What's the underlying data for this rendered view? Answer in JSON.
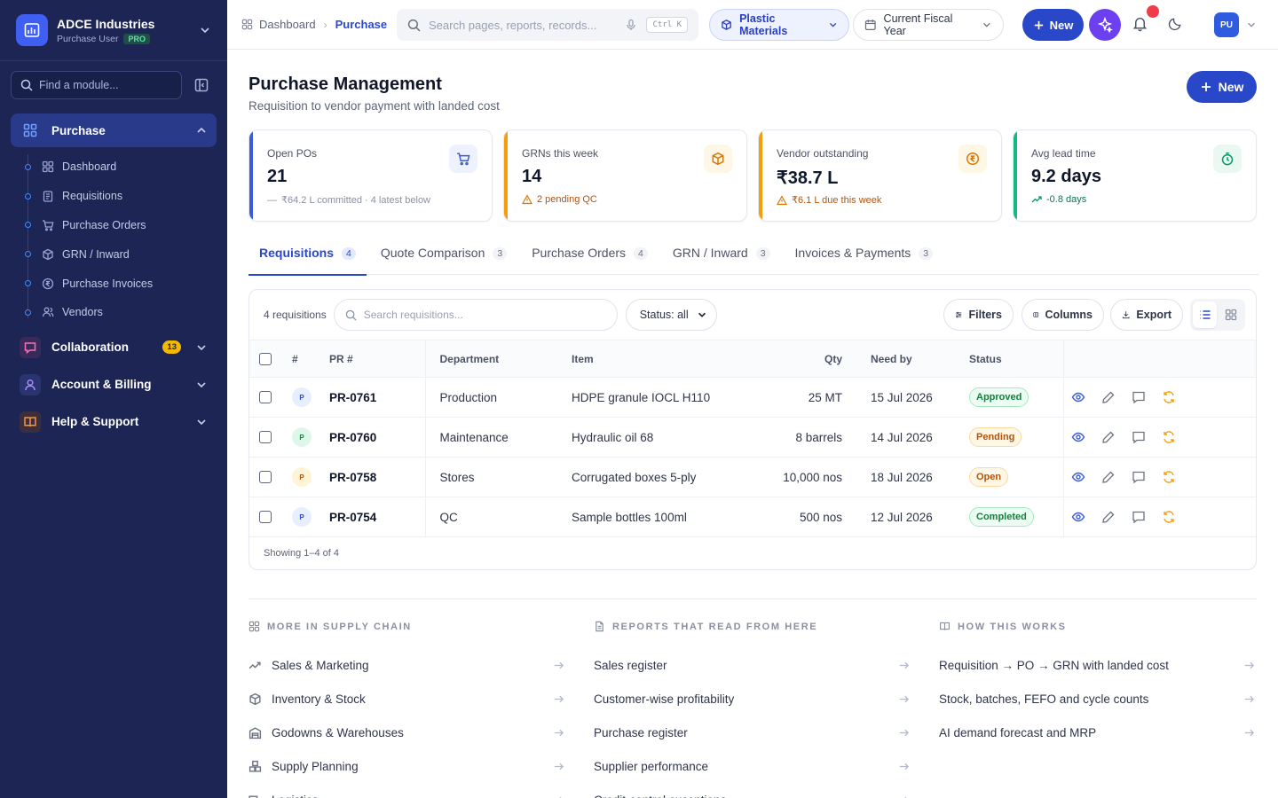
{
  "brand": {
    "name": "ADCE Industries",
    "role": "Purchase User",
    "tier": "PRO"
  },
  "sidebar": {
    "search_placeholder": "Find a module...",
    "groups": [
      {
        "label": "Purchase",
        "active": true,
        "items": [
          {
            "label": "Dashboard",
            "icon": "grid-icon"
          },
          {
            "label": "Requisitions",
            "icon": "clipboard-icon"
          },
          {
            "label": "Purchase Orders",
            "icon": "cart-icon"
          },
          {
            "label": "GRN / Inward",
            "icon": "box-icon"
          },
          {
            "label": "Purchase Invoices",
            "icon": "rupee-icon"
          },
          {
            "label": "Vendors",
            "icon": "users-icon"
          }
        ]
      },
      {
        "label": "Collaboration",
        "badge": "13"
      },
      {
        "label": "Account & Billing"
      },
      {
        "label": "Help & Support"
      }
    ]
  },
  "topbar": {
    "breadcrumb": [
      "Dashboard",
      "Purchase"
    ],
    "search_placeholder": "Search pages, reports, records...",
    "shortcut": "Ctrl K",
    "material": "Plastic Materials",
    "period": "Current Fiscal Year",
    "new_label": "New",
    "user_initials": "PU"
  },
  "page": {
    "title": "Purchase Management",
    "subtitle": "Requisition to vendor payment with landed cost",
    "new_label": "New"
  },
  "kpis": [
    {
      "label": "Open POs",
      "value": "21",
      "note": "₹64.2 L committed · 4 latest below",
      "accent": "#3b5bdb",
      "tone": "neutral"
    },
    {
      "label": "GRNs this week",
      "value": "14",
      "note": "2 pending QC",
      "accent": "#f59e0b",
      "tone": "warn"
    },
    {
      "label": "Vendor outstanding",
      "value": "₹38.7 L",
      "note": "₹6.1 L due this week",
      "accent": "#f59e0b",
      "tone": "warn"
    },
    {
      "label": "Avg lead time",
      "value": "9.2 days",
      "note": "-0.8 days",
      "accent": "#10b981",
      "tone": "good"
    }
  ],
  "tabs": [
    {
      "label": "Requisitions",
      "count": "4",
      "active": true
    },
    {
      "label": "Quote Comparison",
      "count": "3"
    },
    {
      "label": "Purchase Orders",
      "count": "4"
    },
    {
      "label": "GRN / Inward",
      "count": "3"
    },
    {
      "label": "Invoices & Payments",
      "count": "3"
    }
  ],
  "table": {
    "count_label": "4 requisitions",
    "search_placeholder": "Search requisitions...",
    "status_filter": "Status: all",
    "buttons": {
      "filters": "Filters",
      "columns": "Columns",
      "export": "Export"
    },
    "columns": [
      "#",
      "PR #",
      "Department",
      "Item",
      "Qty",
      "Need by",
      "Status"
    ],
    "rows": [
      {
        "avatar": "P",
        "pr": "PR-0761",
        "dept": "Production",
        "item": "HDPE granule IOCL H110",
        "qty": "25 MT",
        "need_by": "15 Jul 2026",
        "status": "Approved"
      },
      {
        "avatar": "P",
        "pr": "PR-0760",
        "dept": "Maintenance",
        "item": "Hydraulic oil 68",
        "qty": "8 barrels",
        "need_by": "14 Jul 2026",
        "status": "Pending"
      },
      {
        "avatar": "P",
        "pr": "PR-0758",
        "dept": "Stores",
        "item": "Corrugated boxes 5-ply",
        "qty": "10,000 nos",
        "need_by": "18 Jul 2026",
        "status": "Open"
      },
      {
        "avatar": "P",
        "pr": "PR-0754",
        "dept": "QC",
        "item": "Sample bottles 100ml",
        "qty": "500 nos",
        "need_by": "12 Jul 2026",
        "status": "Completed"
      }
    ],
    "footer": "Showing 1–4 of 4"
  },
  "footer": {
    "sections": [
      {
        "title": "MORE IN SUPPLY CHAIN",
        "icon": "grid-icon",
        "items": [
          {
            "label": "Sales & Marketing",
            "icon": "trend-icon"
          },
          {
            "label": "Inventory & Stock",
            "icon": "box-icon"
          },
          {
            "label": "Godowns & Warehouses",
            "icon": "warehouse-icon"
          },
          {
            "label": "Supply Planning",
            "icon": "boxes-icon"
          },
          {
            "label": "Logistics",
            "icon": "truck-icon"
          }
        ]
      },
      {
        "title": "REPORTS THAT READ FROM HERE",
        "icon": "file-icon",
        "items": [
          {
            "label": "Sales register"
          },
          {
            "label": "Customer-wise profitability"
          },
          {
            "label": "Purchase register"
          },
          {
            "label": "Supplier performance"
          },
          {
            "label": "Credit-control exceptions"
          }
        ]
      },
      {
        "title": "HOW THIS WORKS",
        "icon": "book-icon",
        "items": [
          {
            "label": "Requisition → PO → GRN with landed cost"
          },
          {
            "label": "Stock, batches, FEFO and cycle counts"
          },
          {
            "label": "AI demand forecast and MRP"
          }
        ]
      }
    ]
  }
}
